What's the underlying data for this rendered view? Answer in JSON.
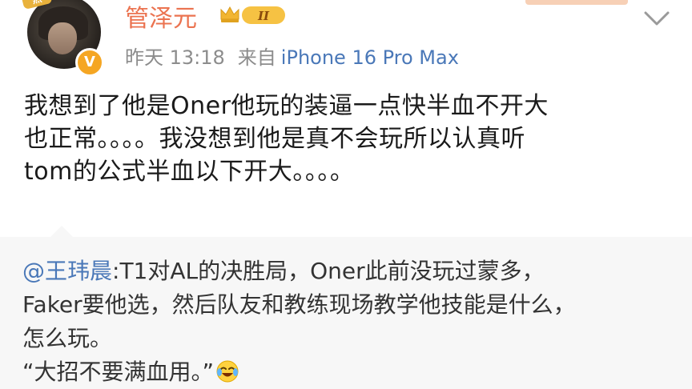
{
  "post": {
    "author": {
      "name": "管泽元",
      "verified_mark": "V",
      "member_level": "II",
      "avatar_icon": "avatar-photo",
      "sticker_text": "热"
    },
    "meta": {
      "time": "昨天 13:18",
      "source_prefix": "来自",
      "device": "iPhone 16 Pro Max"
    },
    "text_lines": [
      "我想到了他是Oner他玩的装逼一点快半血不开大",
      "也正常。。。。我没想到他是真不会玩所以认真听",
      "tom的公式半血以下开大。。。。"
    ]
  },
  "repost": {
    "mention": "@王玮晨",
    "line1_rest": ":T1对AL的决胜局，Oner此前没玩过蒙多，",
    "line2": "Faker要他选，然后队友和教练现场教学他技能是什么，",
    "line3": "怎么玩。",
    "line4": "“大招不要满血用。”",
    "emoji_icon": "laughing-tears-emoji"
  },
  "colors": {
    "author_name": "#eb7350",
    "link": "#4a78b8",
    "meta_gray": "#8c8c8c",
    "repost_bg": "#f7f7f7",
    "badge_gold": "#f5a623"
  }
}
